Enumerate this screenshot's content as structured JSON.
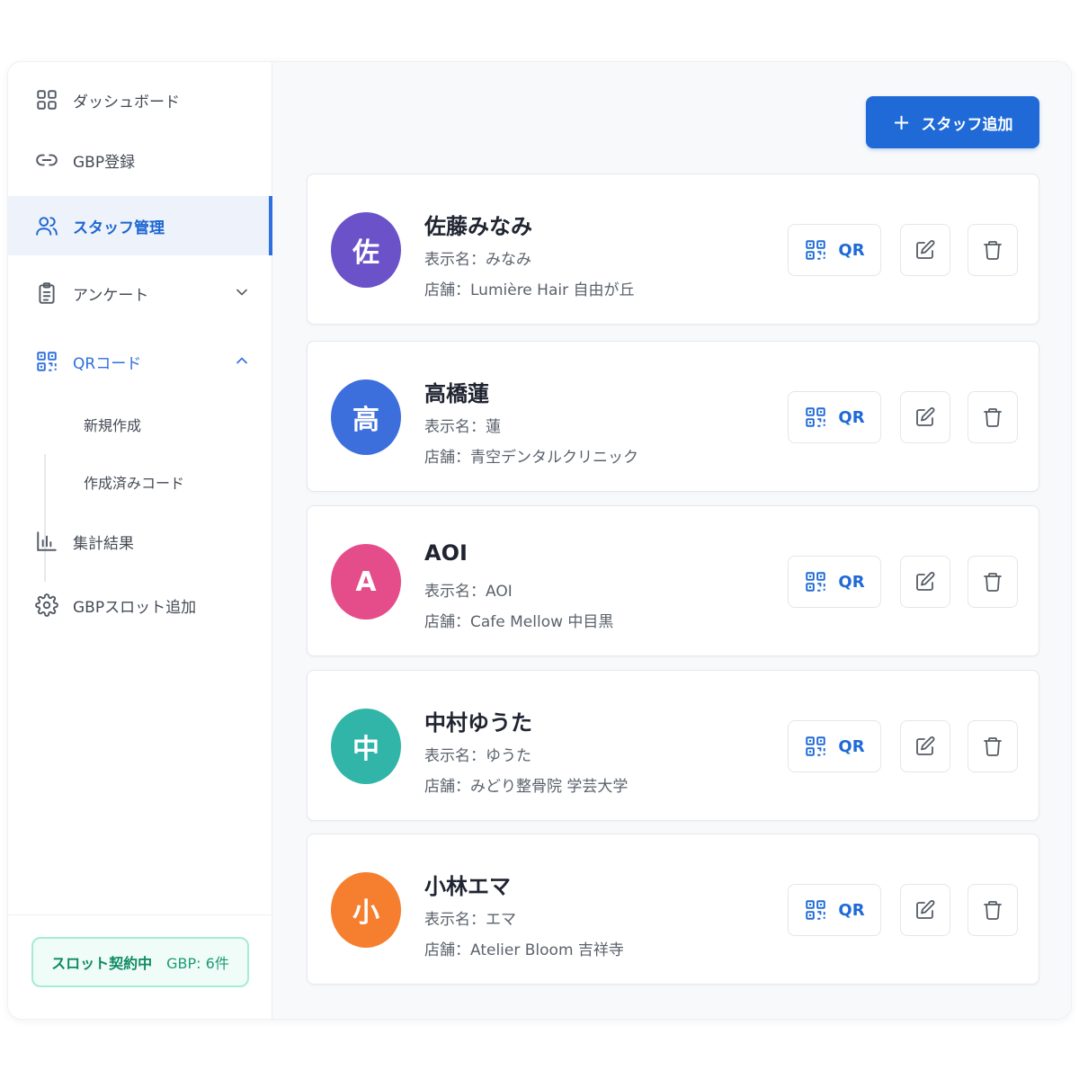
{
  "sidebar": {
    "items": [
      {
        "label": "ダッシュボード"
      },
      {
        "label": "GBP登録"
      },
      {
        "label": "スタッフ管理"
      },
      {
        "label": "アンケート"
      },
      {
        "label": "QRコード"
      },
      {
        "label": "集計結果"
      },
      {
        "label": "GBPスロット追加"
      }
    ],
    "sub_items": [
      {
        "label": "新規作成"
      },
      {
        "label": "作成済みコード"
      }
    ],
    "footer": {
      "status": "スロット契約中",
      "count": "GBP: 6件"
    }
  },
  "main": {
    "add_button": "スタッフ追加",
    "qr_label": "QR",
    "staff": [
      {
        "initial": "佐",
        "name": "佐藤みなみ",
        "display": "表示名：みなみ",
        "store": "店舗：Lumière Hair 自由が丘",
        "color": "#6b52c9"
      },
      {
        "initial": "高",
        "name": "高橋蓮",
        "display": "表示名：蓮",
        "store": "店舗：青空デンタルクリニック",
        "color": "#3d6fdc"
      },
      {
        "initial": "A",
        "name": "AOI",
        "display": "表示名：AOI",
        "store": "店舗：Cafe Mellow 中目黒",
        "color": "#e44c8a"
      },
      {
        "initial": "中",
        "name": "中村ゆうた",
        "display": "表示名：ゆうた",
        "store": "店舗：みどり整骨院 学芸大学",
        "color": "#30b5a8"
      },
      {
        "initial": "小",
        "name": "小林エマ",
        "display": "表示名：エマ",
        "store": "店舗：Atelier Bloom 吉祥寺",
        "color": "#f67f2f"
      }
    ]
  }
}
